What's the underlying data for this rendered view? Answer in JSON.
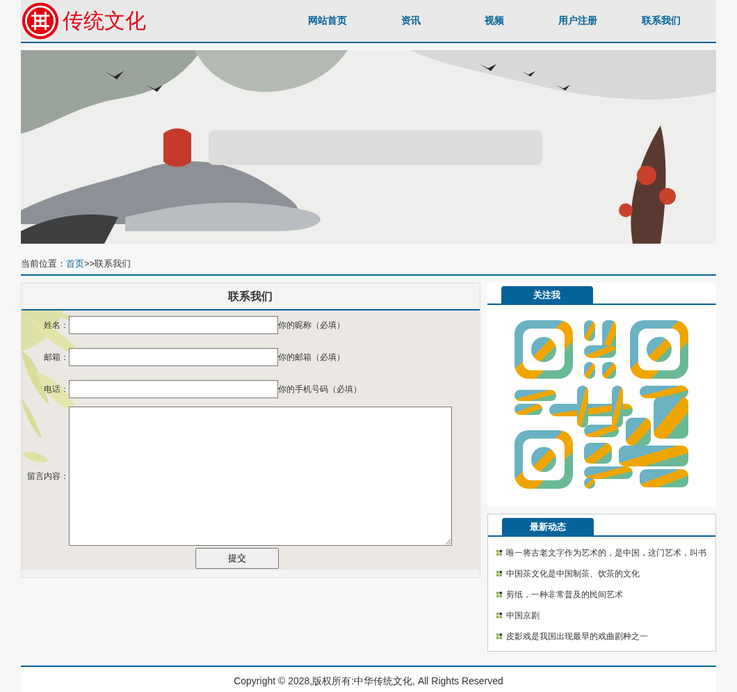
{
  "header": {
    "logo_text": "传统文化",
    "nav": [
      {
        "label": "网站首页"
      },
      {
        "label": "资讯"
      },
      {
        "label": "视频"
      },
      {
        "label": "用户注册"
      },
      {
        "label": "联系我们"
      }
    ]
  },
  "breadcrumb": {
    "prefix": "当前位置：",
    "link": "首页",
    "rest": ">>联系我们"
  },
  "contact_form": {
    "title": "联系我们",
    "fields": [
      {
        "label": "姓名：",
        "hint": "你的昵称（必填）"
      },
      {
        "label": "邮箱：",
        "hint": "你的邮箱（必填）"
      },
      {
        "label": "电话：",
        "hint": "你的手机号码（必填）"
      }
    ],
    "message_label": "留言内容：",
    "submit": "提交"
  },
  "follow": {
    "title": "关注我"
  },
  "news": {
    "title": "最新动态",
    "items": [
      "唯一将古老文字作为艺术的，是中国，这门艺术，叫书",
      "中国茶文化是中国制茶、饮茶的文化",
      "剪纸，一种非常普及的民间艺术",
      "中国京剧",
      "皮影戏是我国出现最早的戏曲剧种之一"
    ]
  },
  "footer": {
    "copyright": "Copyright © 2028,版权所有:中华传统文化, All Rights Reserved"
  }
}
